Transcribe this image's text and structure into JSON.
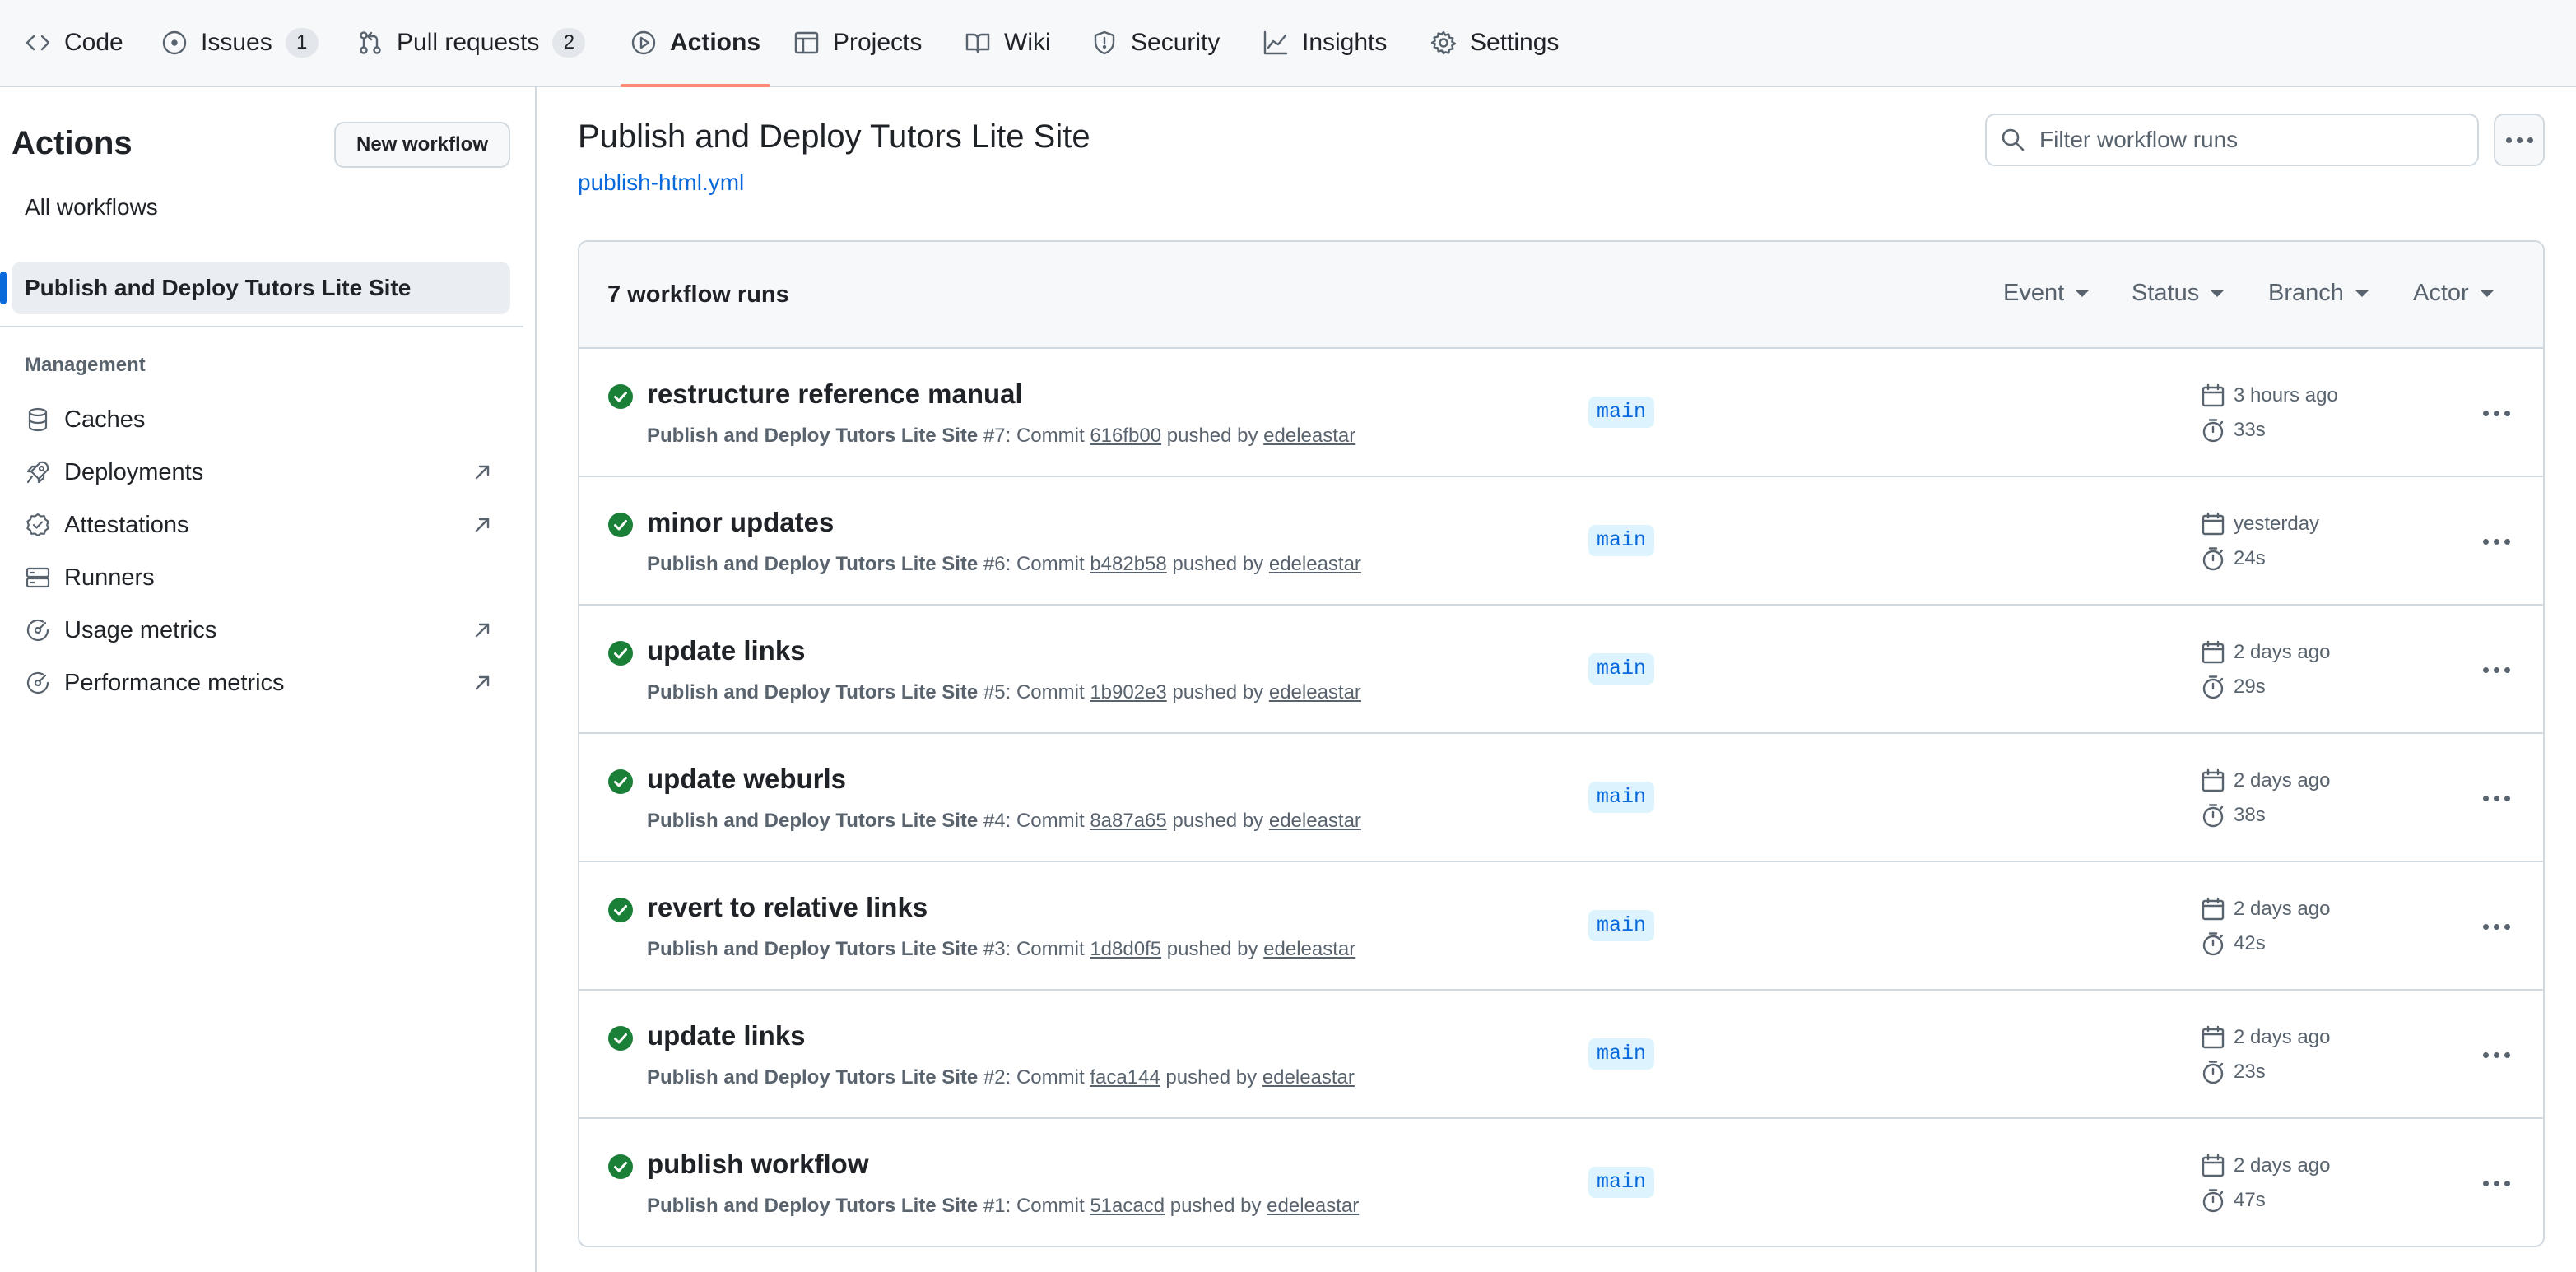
{
  "nav": {
    "tabs": [
      {
        "label": "Code",
        "icon": "code-icon"
      },
      {
        "label": "Issues",
        "icon": "issue-opened-icon",
        "count": "1"
      },
      {
        "label": "Pull requests",
        "icon": "git-pull-request-icon",
        "count": "2"
      },
      {
        "label": "Actions",
        "icon": "play-icon",
        "active": true
      },
      {
        "label": "Projects",
        "icon": "table-icon"
      },
      {
        "label": "Wiki",
        "icon": "book-icon"
      },
      {
        "label": "Security",
        "icon": "shield-icon"
      },
      {
        "label": "Insights",
        "icon": "graph-icon"
      },
      {
        "label": "Settings",
        "icon": "gear-icon"
      }
    ]
  },
  "sidebar": {
    "title": "Actions",
    "new_workflow_label": "New workflow",
    "all_workflows_label": "All workflows",
    "selected_workflow": "Publish and Deploy Tutors Lite Site",
    "management_label": "Management",
    "items": [
      {
        "label": "Caches",
        "icon": "database-icon",
        "external": false
      },
      {
        "label": "Deployments",
        "icon": "rocket-icon",
        "external": true
      },
      {
        "label": "Attestations",
        "icon": "verified-icon",
        "external": true
      },
      {
        "label": "Runners",
        "icon": "server-icon",
        "external": false
      },
      {
        "label": "Usage metrics",
        "icon": "meter-icon",
        "external": true
      },
      {
        "label": "Performance metrics",
        "icon": "meter-icon",
        "external": true
      }
    ]
  },
  "main": {
    "workflow_title": "Publish and Deploy Tutors Lite Site",
    "workflow_file": "publish-html.yml",
    "filter_placeholder": "Filter workflow runs",
    "runs_count_label": "7 workflow runs",
    "header_filters": [
      "Event",
      "Status",
      "Branch",
      "Actor"
    ],
    "runs": [
      {
        "title": "restructure reference manual",
        "workflow": "Publish and Deploy Tutors Lite Site",
        "number": "#7",
        "commit": "616fb00",
        "actor": "edeleastar",
        "branch": "main",
        "when": "3 hours ago",
        "duration": "33s"
      },
      {
        "title": "minor updates",
        "workflow": "Publish and Deploy Tutors Lite Site",
        "number": "#6",
        "commit": "b482b58",
        "actor": "edeleastar",
        "branch": "main",
        "when": "yesterday",
        "duration": "24s"
      },
      {
        "title": "update links",
        "workflow": "Publish and Deploy Tutors Lite Site",
        "number": "#5",
        "commit": "1b902e3",
        "actor": "edeleastar",
        "branch": "main",
        "when": "2 days ago",
        "duration": "29s"
      },
      {
        "title": "update weburls",
        "workflow": "Publish and Deploy Tutors Lite Site",
        "number": "#4",
        "commit": "8a87a65",
        "actor": "edeleastar",
        "branch": "main",
        "when": "2 days ago",
        "duration": "38s"
      },
      {
        "title": "revert to relative links",
        "workflow": "Publish and Deploy Tutors Lite Site",
        "number": "#3",
        "commit": "1d8d0f5",
        "actor": "edeleastar",
        "branch": "main",
        "when": "2 days ago",
        "duration": "42s"
      },
      {
        "title": "update links",
        "workflow": "Publish and Deploy Tutors Lite Site",
        "number": "#2",
        "commit": "faca144",
        "actor": "edeleastar",
        "branch": "main",
        "when": "2 days ago",
        "duration": "23s"
      },
      {
        "title": "publish workflow",
        "workflow": "Publish and Deploy Tutors Lite Site",
        "number": "#1",
        "commit": "51acacd",
        "actor": "edeleastar",
        "branch": "main",
        "when": "2 days ago",
        "duration": "47s"
      }
    ]
  },
  "colors": {
    "accent": "#0969da",
    "success": "#1a7f37",
    "active_tab_underline": "#fd8c73"
  }
}
